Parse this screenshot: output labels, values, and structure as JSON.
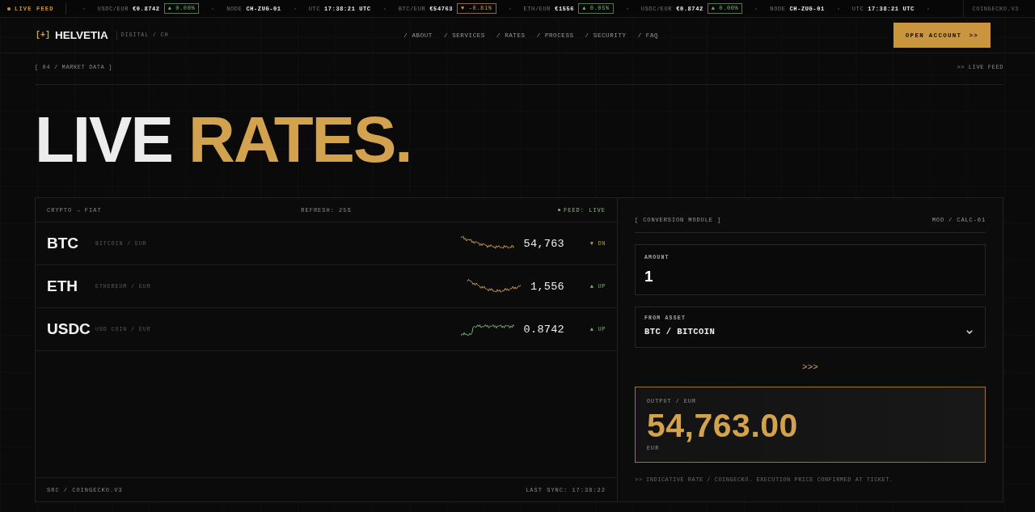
{
  "ticker": {
    "label": "LIVE FEED",
    "items": [
      {
        "kind": "up",
        "pair": "USDC/EUR",
        "price": "€0.8742",
        "change": "▲ 0.00%"
      },
      {
        "kind": "info",
        "label": "NODE",
        "value": "CH-ZUG-01"
      },
      {
        "kind": "info",
        "label": "UTC",
        "value": "17:38:21 UTC"
      },
      {
        "kind": "down",
        "pair": "BTC/EUR",
        "price": "€54763",
        "change": "▼ -0.81%"
      },
      {
        "kind": "up",
        "pair": "ETH/EUR",
        "price": "€1556",
        "change": "▲ 0.05%"
      },
      {
        "kind": "up",
        "pair": "USDC/EUR",
        "price": "€0.8742",
        "change": "▲ 0.00%"
      },
      {
        "kind": "info",
        "label": "NODE",
        "value": "CH-ZUG-01"
      },
      {
        "kind": "info",
        "label": "UTC",
        "value": "17:38:21 UTC"
      }
    ],
    "source": "COINGECKO.V3"
  },
  "nav": {
    "logo_mark": "[+]",
    "brand": "HELVETIA",
    "tagline": "DIGITAL / CH",
    "links": [
      "/ ABOUT",
      "/ SERVICES",
      "/ RATES",
      "/ PROCESS",
      "/ SECURITY",
      "/ FAQ"
    ],
    "cta": "OPEN ACCOUNT",
    "cta_arrows": ">>"
  },
  "section": {
    "label": "[ 04 / MARKET DATA ]",
    "feed": ">> LIVE FEED"
  },
  "hero": {
    "title": "LIVE",
    "title_accent": "RATES."
  },
  "rates": {
    "caption": "CRYPTO → FIAT",
    "refresh": "REFRESH: 25S",
    "status": "FEED: LIVE",
    "rows": [
      {
        "kind": "bearish",
        "symbol": "BTC",
        "name": "BITCOIN / EUR",
        "price": "54,763",
        "trend_label": "▼ DN"
      },
      {
        "kind": "recovering",
        "symbol": "ETH",
        "name": "ETHEREUM / EUR",
        "price": "1,556",
        "trend_label": "▲ UP"
      },
      {
        "kind": "bullish",
        "symbol": "USDC",
        "name": "USD COIN / EUR",
        "price": "0.8742",
        "trend_label": "▲ UP"
      }
    ],
    "source": "SRC / COINGECKO.V3",
    "last_sync": "LAST SYNC: 17:38:22"
  },
  "converter": {
    "title": "[ CONVERSION MODULE ]",
    "module_id": "MOD / CALC-01",
    "amount": {
      "label": "AMOUNT",
      "value": "1"
    },
    "from_asset": {
      "label": "FROM ASSET",
      "value": "BTC / BITCOIN"
    },
    "arrows": ">>>",
    "output": {
      "label": "OUTPUT / EUR",
      "value": "54,763.00",
      "currency": "EUR"
    },
    "note": ">> INDICATIVE RATE / COINGECKO. EXECUTION PRICE CONFIRMED AT TICKET."
  }
}
